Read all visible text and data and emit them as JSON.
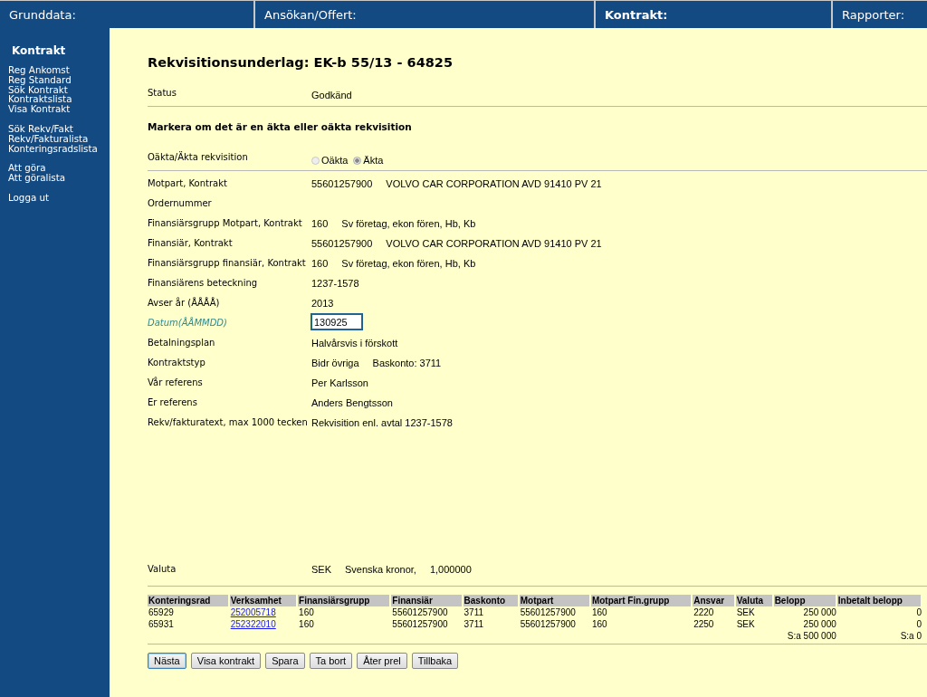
{
  "top_nav": [
    {
      "label": "Grunddata:",
      "selected": false
    },
    {
      "label": "Ansökan/Offert:",
      "selected": false
    },
    {
      "label": "Kontrakt:",
      "selected": true
    },
    {
      "label": "Rapporter:",
      "selected": false
    }
  ],
  "sidebar": {
    "title": "Kontrakt",
    "groups": [
      [
        "Reg Ankomst",
        "Reg Standard",
        "Sök Kontrakt",
        "Kontraktslista",
        "Visa Kontrakt"
      ],
      [
        "Sök Rekv/Fakt",
        "Rekv/Fakturalista",
        "Konteringsradslista"
      ],
      [
        "Att göra",
        "Att göralista"
      ],
      [
        "Logga ut"
      ]
    ]
  },
  "page_title": "Rekvisitionsunderlag: EK-b 55/13 - 64825",
  "status": {
    "label": "Status",
    "value": "Godkänd"
  },
  "instruction": "Markera om det är en äkta eller oäkta rekvisition",
  "radio_row": {
    "label": "Oäkta/Äkta rekvisition",
    "options": [
      {
        "label": "Oäkta",
        "selected": false
      },
      {
        "label": "Äkta",
        "selected": true
      }
    ]
  },
  "fields": [
    {
      "kind": "text",
      "label": "Motpart, Kontrakt",
      "values": [
        "55601257900",
        "VOLVO CAR CORPORATION AVD 91410 PV 21"
      ]
    },
    {
      "kind": "text",
      "label": "Ordernummer"
    },
    {
      "kind": "text",
      "label": "Finansiärsgrupp Motpart, Kontrakt",
      "values": [
        "160",
        "Sv företag, ekon fören, Hb, Kb"
      ]
    },
    {
      "kind": "text",
      "label": "Finansiär, Kontrakt",
      "values": [
        "55601257900",
        "VOLVO CAR CORPORATION AVD 91410 PV 21"
      ]
    },
    {
      "kind": "text",
      "label": "Finansiärsgrupp finansiär, Kontrakt",
      "values": [
        "160",
        "Sv företag, ekon fören, Hb, Kb"
      ]
    },
    {
      "kind": "text",
      "label": "Finansiärens beteckning",
      "values": [
        "1237-1578"
      ]
    },
    {
      "kind": "text",
      "label": "Avser år (ÅÅÅÅ)",
      "values": [
        "2013"
      ]
    },
    {
      "kind": "input",
      "label": "Datum(ÅÅMMDD)",
      "values": [
        "130925"
      ]
    },
    {
      "kind": "text",
      "label": "Betalningsplan",
      "values": [
        "Halvårsvis i förskott"
      ]
    },
    {
      "kind": "text",
      "label": "Kontraktstyp",
      "values": [
        "Bidr övriga",
        "Baskonto: 3711"
      ]
    },
    {
      "kind": "text",
      "label": "Vår referens",
      "values": [
        "Per Karlsson"
      ]
    },
    {
      "kind": "text",
      "label": "Er referens",
      "values": [
        "Anders Bengtsson"
      ]
    },
    {
      "kind": "text",
      "label": "Rekv/fakturatext, max 1000 tecken",
      "values": [
        "Rekvisition enl. avtal 1237-1578"
      ]
    }
  ],
  "currency": {
    "label": "Valuta",
    "values": [
      "SEK",
      "Svenska kronor,",
      "1,000000"
    ]
  },
  "table": {
    "columns": [
      "Konteringsrad",
      "Verksamhet",
      "Finansiärsgrupp",
      "Finansiär",
      "Baskonto",
      "Motpart",
      "Motpart Fin.grupp",
      "Ansvar",
      "Valuta",
      "Belopp",
      "Inbetalt belopp"
    ],
    "rows": [
      [
        "65929",
        "252005718",
        "160",
        "55601257900",
        "3711",
        "55601257900",
        "160",
        "2220",
        "SEK",
        "250 000",
        "0"
      ],
      [
        "65931",
        "252322010",
        "160",
        "55601257900",
        "3711",
        "55601257900",
        "160",
        "2250",
        "SEK",
        "250 000",
        "0"
      ]
    ],
    "totals": {
      "Belopp": "S:a 500 000",
      "Inbetalt": "S:a 0"
    }
  },
  "buttons": [
    {
      "label": "Nästa",
      "focused": true
    },
    {
      "label": "Visa kontrakt",
      "focused": false
    },
    {
      "label": "Spara",
      "focused": false
    },
    {
      "label": "Ta bort",
      "focused": false
    },
    {
      "label": "Åter prel",
      "focused": false
    },
    {
      "label": "Tillbaka",
      "focused": false
    }
  ]
}
